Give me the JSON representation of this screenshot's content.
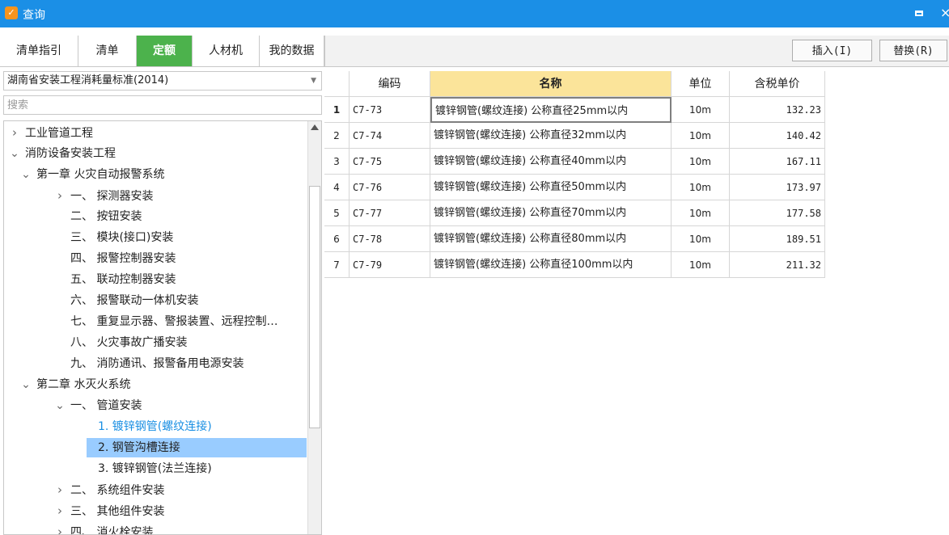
{
  "window": {
    "title": "查询"
  },
  "tabs": [
    {
      "label": "清单指引",
      "active": false
    },
    {
      "label": "清单",
      "active": false
    },
    {
      "label": "定额",
      "active": true
    },
    {
      "label": "人材机",
      "active": false
    },
    {
      "label": "我的数据",
      "active": false
    }
  ],
  "toolbar": {
    "insert_label": "插入(I)",
    "replace_label": "替换(R)"
  },
  "library": {
    "selected": "湖南省安装工程消耗量标准(2014)"
  },
  "search": {
    "placeholder": "搜索"
  },
  "tree": [
    {
      "label": "工业管道工程",
      "level": 0,
      "arrow": "collapsed"
    },
    {
      "label": "消防设备安装工程",
      "level": 0,
      "arrow": "expanded"
    },
    {
      "label": "第一章 火灾自动报警系统",
      "level": 1,
      "arrow": "expanded"
    },
    {
      "label": "一、 探测器安装",
      "level": 2,
      "arrow": "collapsed"
    },
    {
      "label": "二、 按钮安装",
      "level": 2,
      "arrow": "none"
    },
    {
      "label": "三、 模块(接口)安装",
      "level": 2,
      "arrow": "none"
    },
    {
      "label": "四、 报警控制器安装",
      "level": 2,
      "arrow": "none"
    },
    {
      "label": "五、 联动控制器安装",
      "level": 2,
      "arrow": "none"
    },
    {
      "label": "六、 报警联动一体机安装",
      "level": 2,
      "arrow": "none"
    },
    {
      "label": "七、 重复显示器、警报装置、远程控制…",
      "level": 2,
      "arrow": "none"
    },
    {
      "label": "八、 火灾事故广播安装",
      "level": 2,
      "arrow": "none"
    },
    {
      "label": "九、 消防通讯、报警备用电源安装",
      "level": 2,
      "arrow": "none"
    },
    {
      "label": "第二章 水灭火系统",
      "level": 1,
      "arrow": "expanded"
    },
    {
      "label": "一、 管道安装",
      "level": 2,
      "arrow": "expanded"
    },
    {
      "label": "1. 镀锌钢管(螺纹连接)",
      "level": 3,
      "arrow": "none",
      "state": "link"
    },
    {
      "label": "2. 钢管沟槽连接",
      "level": 3,
      "arrow": "none",
      "state": "selected"
    },
    {
      "label": "3. 镀锌钢管(法兰连接)",
      "level": 3,
      "arrow": "none"
    },
    {
      "label": "二、 系统组件安装",
      "level": 2,
      "arrow": "collapsed"
    },
    {
      "label": "三、 其他组件安装",
      "level": 2,
      "arrow": "collapsed"
    },
    {
      "label": "四、 消火栓安装",
      "level": 2,
      "arrow": "collapsed"
    }
  ],
  "grid": {
    "headers": {
      "code": "编码",
      "name": "名称",
      "unit": "单位",
      "price": "含税单价"
    },
    "rows": [
      {
        "idx": "1",
        "code": "C7-73",
        "name": "镀锌钢管(螺纹连接) 公称直径25mm以内",
        "unit": "10m",
        "price": "132.23"
      },
      {
        "idx": "2",
        "code": "C7-74",
        "name": "镀锌钢管(螺纹连接) 公称直径32mm以内",
        "unit": "10m",
        "price": "140.42"
      },
      {
        "idx": "3",
        "code": "C7-75",
        "name": "镀锌钢管(螺纹连接) 公称直径40mm以内",
        "unit": "10m",
        "price": "167.11"
      },
      {
        "idx": "4",
        "code": "C7-76",
        "name": "镀锌钢管(螺纹连接) 公称直径50mm以内",
        "unit": "10m",
        "price": "173.97"
      },
      {
        "idx": "5",
        "code": "C7-77",
        "name": "镀锌钢管(螺纹连接) 公称直径70mm以内",
        "unit": "10m",
        "price": "177.58"
      },
      {
        "idx": "6",
        "code": "C7-78",
        "name": "镀锌钢管(螺纹连接) 公称直径80mm以内",
        "unit": "10m",
        "price": "189.51"
      },
      {
        "idx": "7",
        "code": "C7-79",
        "name": "镀锌钢管(螺纹连接) 公称直径100mm以内",
        "unit": "10m",
        "price": "211.32"
      }
    ]
  },
  "colors": {
    "titlebar": "#1b8fe6",
    "active_tab": "#4cb24c",
    "name_header": "#fbe49a",
    "selected_row": "#99ccff",
    "link": "#1a8fe3"
  }
}
